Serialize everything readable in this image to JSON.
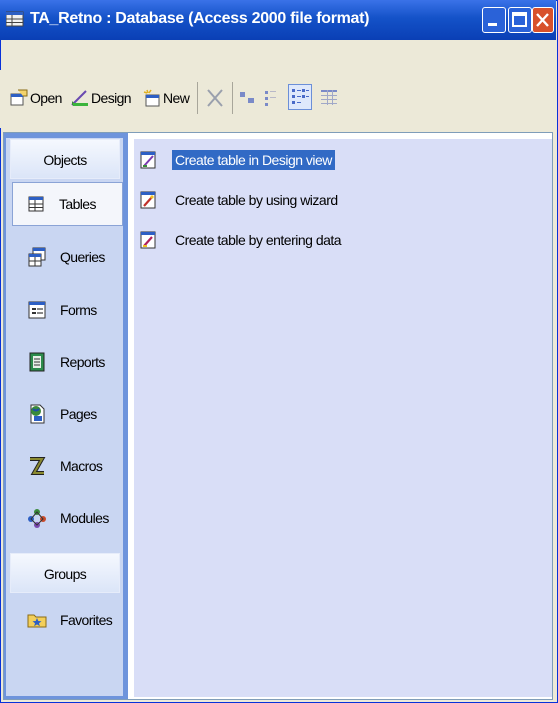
{
  "window": {
    "title": "TA_Retno : Database (Access 2000 file format)",
    "title_icon": "database-window-icon",
    "controls": [
      "minimize-icon",
      "maximize-icon",
      "close-icon"
    ]
  },
  "toolbar": {
    "open_label": "Open",
    "design_label": "Design",
    "new_label": "New",
    "icons": [
      "delete-icon",
      "large-icons-view-icon",
      "small-icons-view-icon",
      "list-view-icon",
      "details-view-icon"
    ]
  },
  "objects_bar": {
    "header": "Objects",
    "items": [
      {
        "label": "Tables",
        "icon": "table-icon",
        "selected": true
      },
      {
        "label": "Queries",
        "icon": "query-icon",
        "selected": false
      },
      {
        "label": "Forms",
        "icon": "form-icon",
        "selected": false
      },
      {
        "label": "Reports",
        "icon": "report-icon",
        "selected": false
      },
      {
        "label": "Pages",
        "icon": "page-icon",
        "selected": false
      },
      {
        "label": "Macros",
        "icon": "macro-icon",
        "selected": false
      },
      {
        "label": "Modules",
        "icon": "module-icon",
        "selected": false
      }
    ],
    "groups_header": "Groups",
    "groups": [
      {
        "label": "Favorites",
        "icon": "favorites-folder-icon"
      }
    ]
  },
  "list": {
    "items": [
      {
        "label": "Create table in Design view",
        "icon": "design-view-icon",
        "selected": true
      },
      {
        "label": "Create table by using wizard",
        "icon": "wizard-icon",
        "selected": false
      },
      {
        "label": "Create table by entering data",
        "icon": "datasheet-icon",
        "selected": false
      }
    ]
  },
  "colors": {
    "titlebar": "#0a3fb5",
    "selection": "#316ac5",
    "objects_bar": "#c9d6f2",
    "list_background": "#d9def7"
  }
}
